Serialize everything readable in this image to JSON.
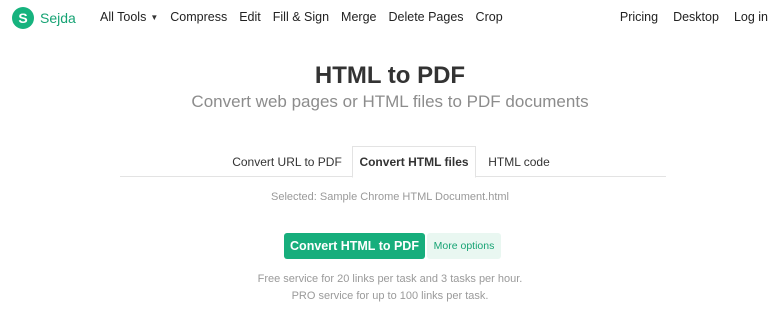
{
  "brand": {
    "name": "Sejda",
    "logo_letter": "S",
    "color": "#16b37e"
  },
  "nav": {
    "left": [
      "All Tools",
      "Compress",
      "Edit",
      "Fill & Sign",
      "Merge",
      "Delete Pages",
      "Crop"
    ],
    "all_tools_has_dropdown": true,
    "right": [
      "Pricing",
      "Desktop",
      "Log in"
    ]
  },
  "header": {
    "title": "HTML to PDF",
    "subtitle": "Convert web pages or HTML files to PDF documents"
  },
  "tabs": [
    {
      "label": "Convert URL to PDF",
      "active": false
    },
    {
      "label": "Convert HTML files",
      "active": true
    },
    {
      "label": "HTML code",
      "active": false
    }
  ],
  "selected_text": "Selected: Sample Chrome HTML Document.html",
  "actions": {
    "convert_label": "Convert HTML to PDF",
    "more_label": "More options"
  },
  "notes": {
    "line1": "Free service for 20 links per task and 3 tasks per hour.",
    "line2": "PRO service for up to 100 links per task."
  },
  "colors": {
    "accent": "#17ae7c",
    "accent_light": "#e9f7f1",
    "muted_text": "#9a9a9a"
  }
}
